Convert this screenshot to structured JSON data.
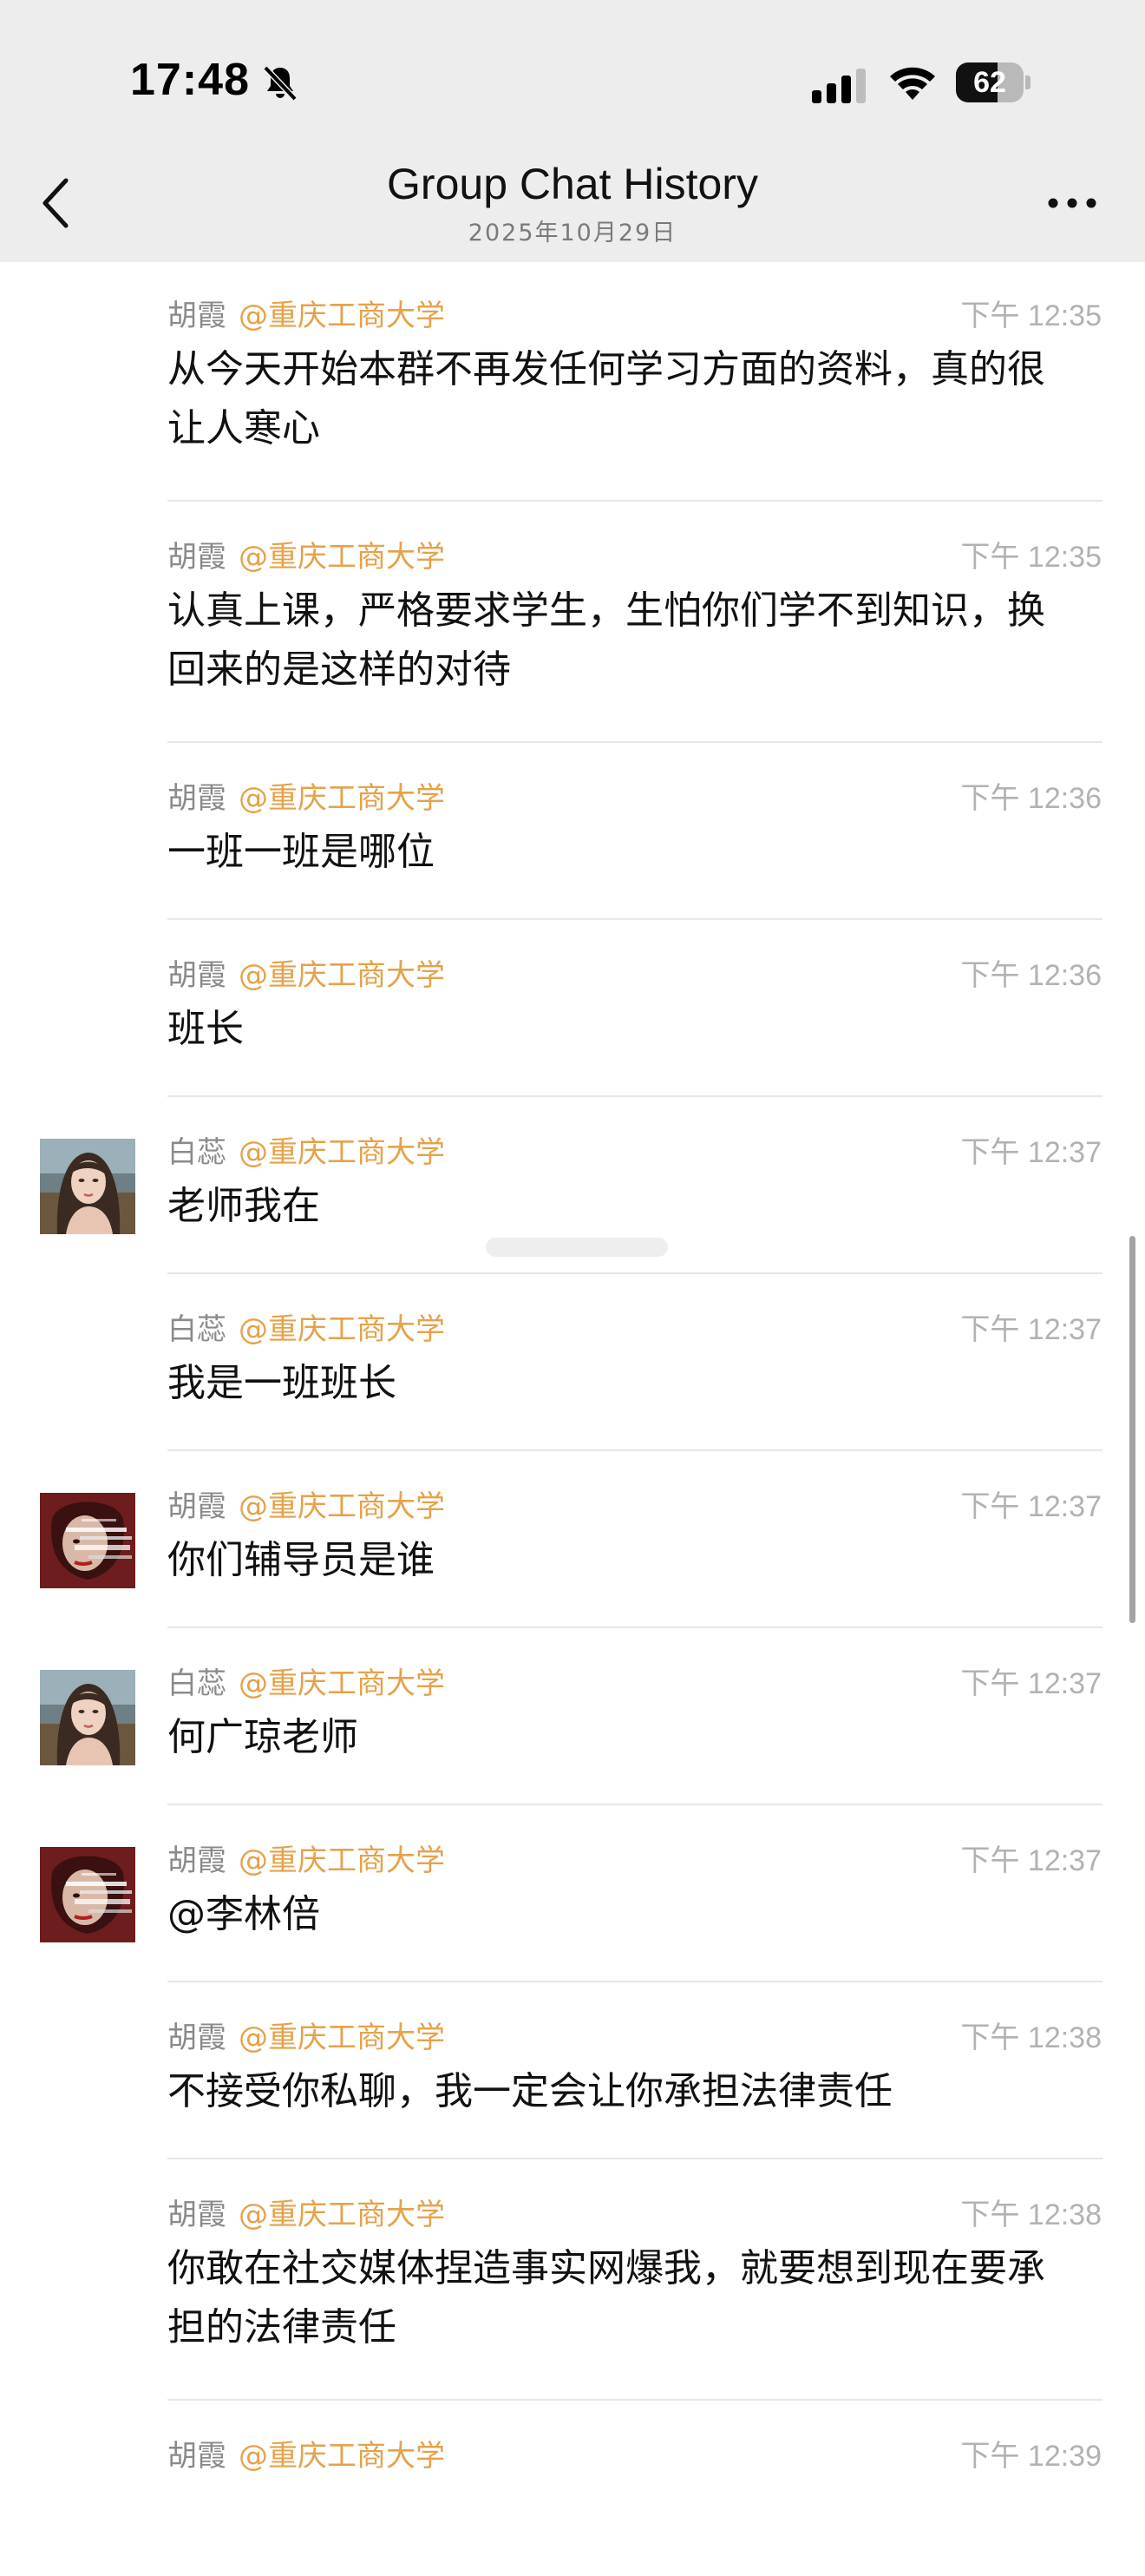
{
  "status_bar": {
    "time": "17:48",
    "battery": "62",
    "battery_level": 0.62
  },
  "header": {
    "title": "Group Chat History",
    "subtitle": "2025年10月29日"
  },
  "messages": [
    {
      "sender": "胡霞",
      "group": "@重庆工商大学",
      "time": "下午 12:35",
      "text": "从今天开始本群不再发任何学习方面的资料，真的很让人寒心",
      "avatar": ""
    },
    {
      "sender": "胡霞",
      "group": "@重庆工商大学",
      "time": "下午 12:35",
      "text": "认真上课，严格要求学生，生怕你们学不到知识，换回来的是这样的对待",
      "avatar": ""
    },
    {
      "sender": "胡霞",
      "group": "@重庆工商大学",
      "time": "下午 12:36",
      "text": "一班一班是哪位",
      "avatar": ""
    },
    {
      "sender": "胡霞",
      "group": "@重庆工商大学",
      "time": "下午 12:36",
      "text": "班长",
      "avatar": ""
    },
    {
      "sender": "白蕊",
      "group": "@重庆工商大学",
      "time": "下午 12:37",
      "text": "老师我在",
      "avatar": "portrait-woman"
    },
    {
      "sender": "白蕊",
      "group": "@重庆工商大学",
      "time": "下午 12:37",
      "text": "我是一班班长",
      "avatar": ""
    },
    {
      "sender": "胡霞",
      "group": "@重庆工商大学",
      "time": "下午 12:37",
      "text": "你们辅导员是谁",
      "avatar": "glitch-face"
    },
    {
      "sender": "白蕊",
      "group": "@重庆工商大学",
      "time": "下午 12:37",
      "text": "何广琼老师",
      "avatar": "portrait-woman"
    },
    {
      "sender": "胡霞",
      "group": "@重庆工商大学",
      "time": "下午 12:37",
      "text": "@李林倍",
      "avatar": "glitch-face"
    },
    {
      "sender": "胡霞",
      "group": "@重庆工商大学",
      "time": "下午 12:38",
      "text": "不接受你私聊，我一定会让你承担法律责任",
      "avatar": ""
    },
    {
      "sender": "胡霞",
      "group": "@重庆工商大学",
      "time": "下午 12:38",
      "text": "你敢在社交媒体捏造事实网爆我，就要想到现在要承担的法律责任",
      "avatar": ""
    },
    {
      "sender": "胡霞",
      "group": "@重庆工商大学",
      "time": "下午 12:39",
      "text": "",
      "avatar": ""
    }
  ],
  "icons": {
    "back": "back-chevron-icon",
    "more": "more-dots-icon",
    "bell": "bell-slash-icon",
    "signal": "cellular-signal-icon",
    "wifi": "wifi-icon"
  },
  "colors": {
    "header_bg": "#ededed",
    "group_tag": "#e5a24a",
    "sender": "#8a8a8a",
    "time": "#b2b2b2"
  }
}
